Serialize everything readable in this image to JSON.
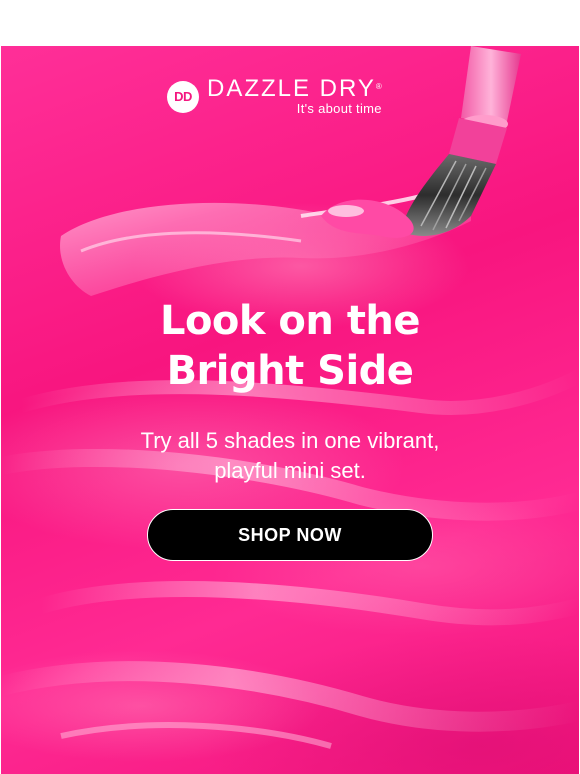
{
  "brand": {
    "badge_text": "DD",
    "name": "DAZZLE DRY",
    "trademark": "®",
    "tagline": "It's about time"
  },
  "hero": {
    "headline_line1": "Look on the",
    "headline_line2": "Bright Side",
    "subhead_line1": "Try all 5 shades in one vibrant,",
    "subhead_line2": "playful mini set.",
    "cta_label": "SHOP NOW",
    "image_subject": "nail-polish-brush-in-pink-polish"
  },
  "colors": {
    "background": "#ffffff",
    "hero_pink": "#f8157f",
    "cta_background": "#000000",
    "text": "#ffffff"
  }
}
